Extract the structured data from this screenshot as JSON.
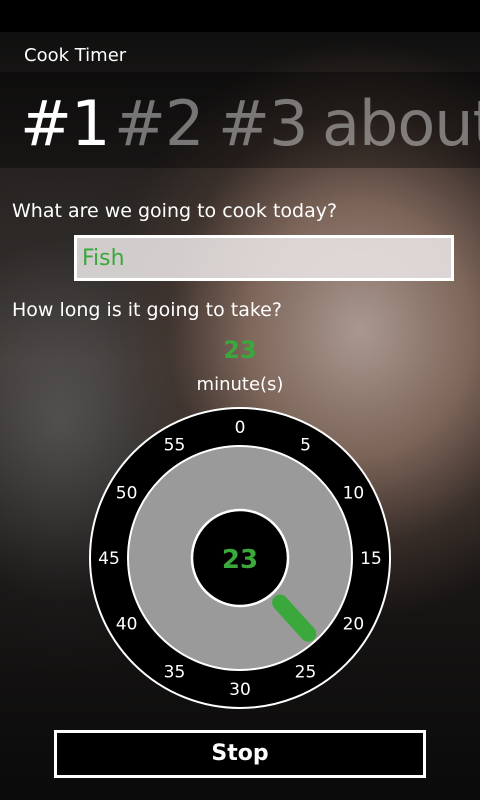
{
  "app": {
    "title": "Cook Timer"
  },
  "pivot": {
    "items": [
      {
        "label": "#1",
        "active": true
      },
      {
        "label": "#2",
        "active": false
      },
      {
        "label": "#3",
        "active": false
      },
      {
        "label": "about",
        "active": false
      }
    ]
  },
  "form": {
    "dish_question": "What are we going to cook today?",
    "dish_value": "Fish",
    "duration_question": "How long is it going to take?"
  },
  "timer": {
    "minutes": 23,
    "minutes_label": "23",
    "unit_label": "minute(s)",
    "dial_labels": [
      "0",
      "5",
      "10",
      "15",
      "20",
      "25",
      "30",
      "35",
      "40",
      "45",
      "50",
      "55"
    ],
    "dial_max_minutes": 60,
    "center_label": "23"
  },
  "actions": {
    "stop_label": "Stop"
  },
  "colors": {
    "accent": "#3aa83a",
    "dial_face": "#9a9a9a",
    "dial_ring": "#000000",
    "dial_border": "#ffffff",
    "center_hole": "#000000"
  }
}
